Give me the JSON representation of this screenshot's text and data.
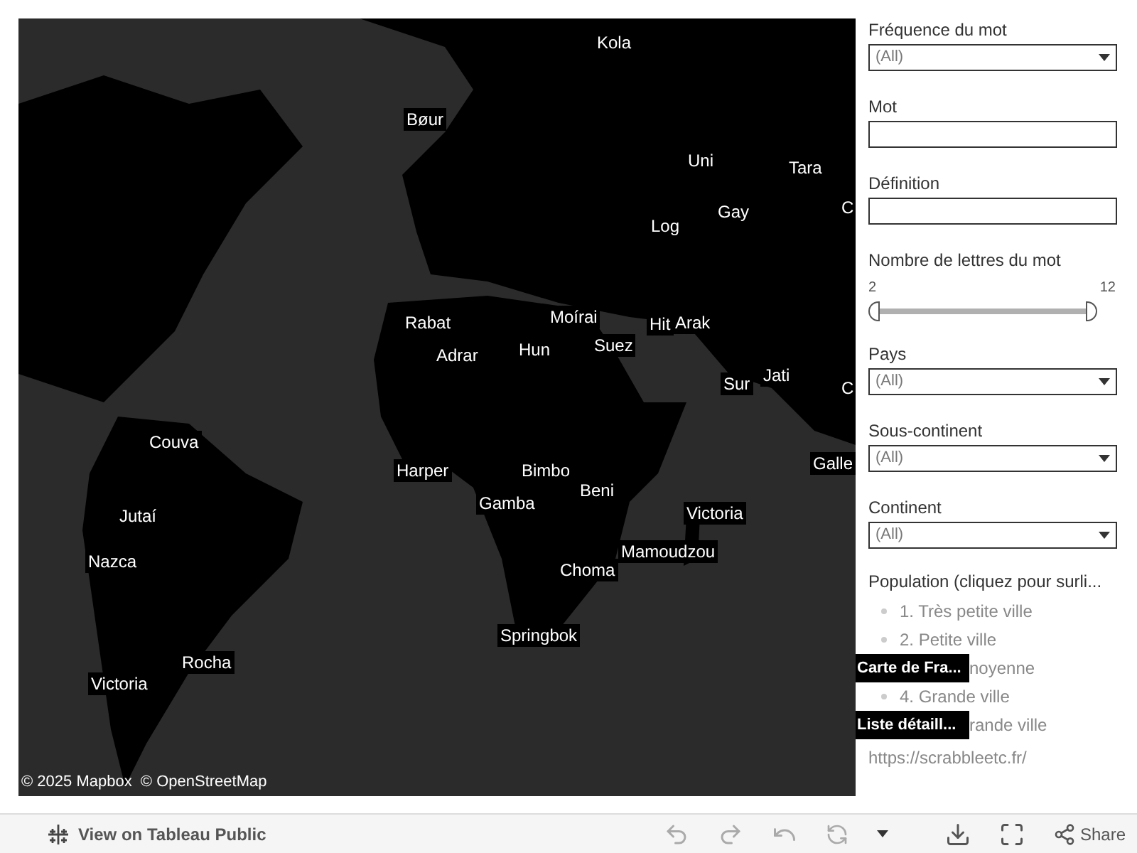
{
  "map": {
    "attribution": "© 2025 Mapbox  © OpenStreetMap",
    "labels": [
      "Kola",
      "Bøur",
      "Uni",
      "Tara",
      "C",
      "Gay",
      "Log",
      "Rabat",
      "Moírai",
      "Hit",
      "Arak",
      "Adrar",
      "Hun",
      "Suez",
      "Sur",
      "Jati",
      "C",
      "Galle",
      "Couva",
      "Harper",
      "Bimbo",
      "Beni",
      "Gamba",
      "Victoria",
      "Jutaí",
      "Nazca",
      "Mamoudzou",
      "Choma",
      "Springbok",
      "Rocha",
      "Victoria"
    ]
  },
  "filters": [
    {
      "kind": "dropdown",
      "label": "Fréquence du mot",
      "value": "(All)"
    },
    {
      "kind": "text",
      "label": "Mot"
    },
    {
      "kind": "text",
      "label": "Définition"
    },
    {
      "kind": "range",
      "label": "Nombre de lettres du mot",
      "min_label": "2",
      "max_label": "12",
      "level": 1
    },
    {
      "kind": "dropdown",
      "label": "Pays",
      "value": "(All)"
    },
    {
      "kind": "dropdown",
      "label": "Sous-continent",
      "value": "(All)"
    },
    {
      "kind": "dropdown",
      "label": "Continent",
      "value": "(All)"
    }
  ],
  "legend": {
    "title": "Population (cliquez pour surli...",
    "items": [
      {
        "text": "1. Très petite ville"
      },
      {
        "text": "2. Petite ville"
      },
      {
        "overlay_button": "Carte de Fra...",
        "text": "noyenne"
      },
      {
        "text": "4. Grande ville"
      },
      {
        "overlay_button": "Liste détaill...",
        "text": "rande ville"
      }
    ]
  },
  "link": "https://scrabbleetc.fr/",
  "toolbar": {
    "view_link": "View on Tableau Public",
    "share": "Share"
  }
}
